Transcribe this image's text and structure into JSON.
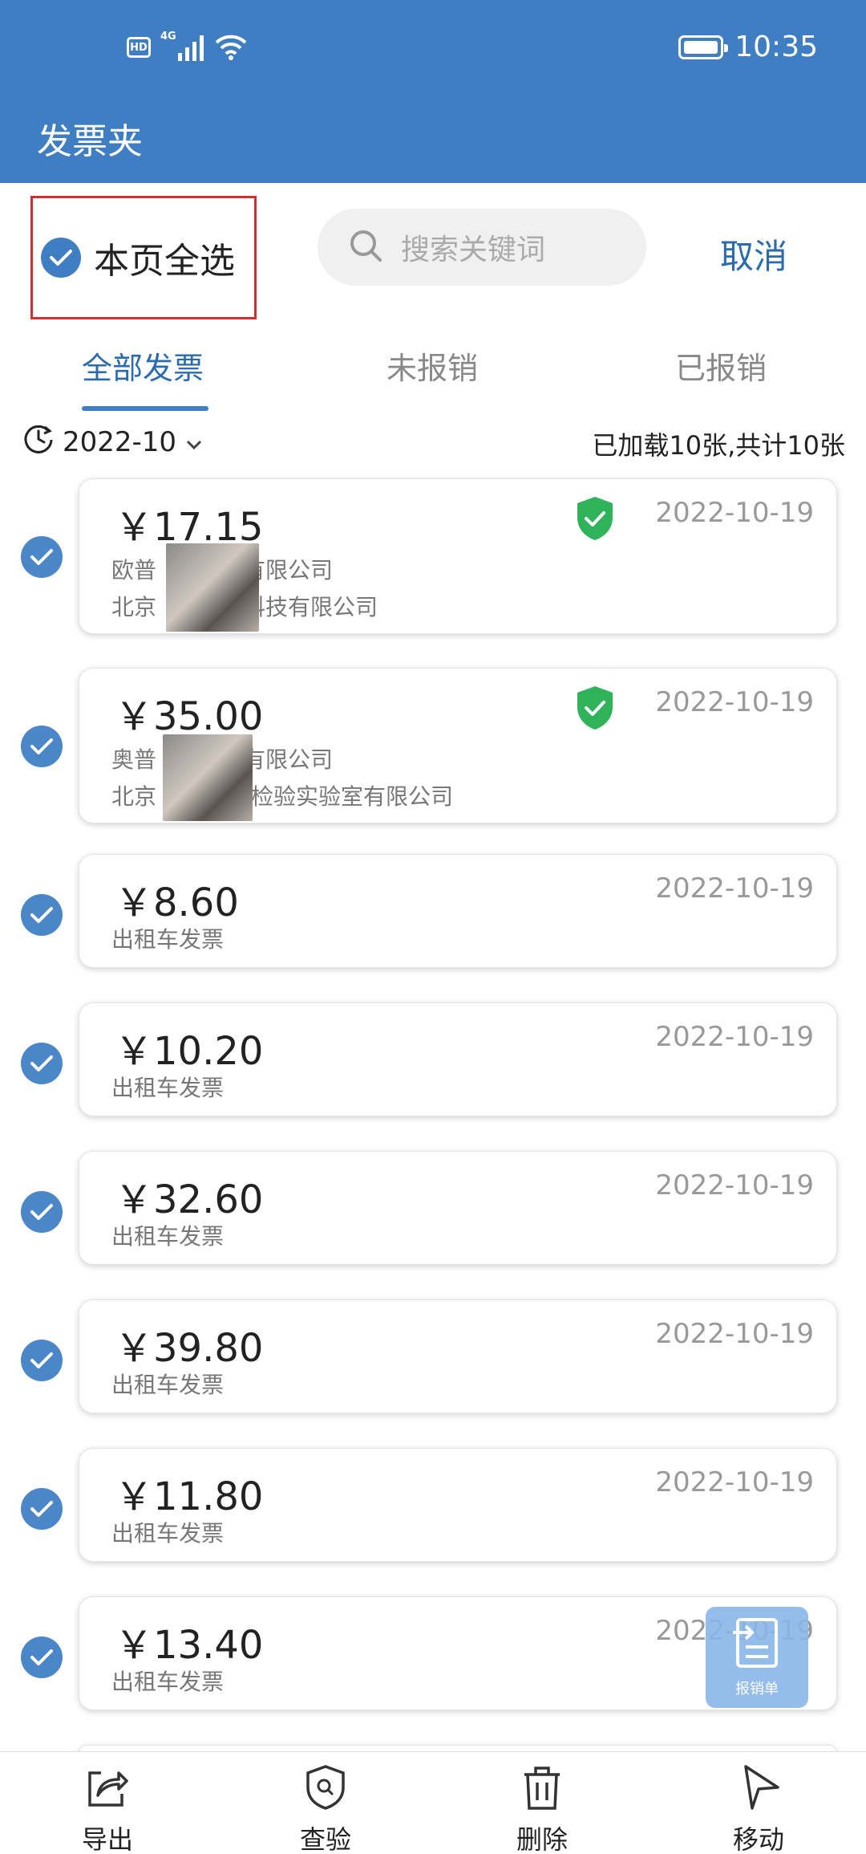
{
  "status_bar": {
    "hd": "HD",
    "network": "4G",
    "time": "10:35"
  },
  "header": {
    "title": "发票夹"
  },
  "toolbar": {
    "select_all_label": "本页全选",
    "search_placeholder": "搜索关键词",
    "cancel_label": "取消"
  },
  "tabs": [
    {
      "label": "全部发票",
      "active": true
    },
    {
      "label": "未报销",
      "active": false
    },
    {
      "label": "已报销",
      "active": false
    }
  ],
  "filter": {
    "month": "2022-10",
    "loaded_text": "已加载10张,共计10张"
  },
  "invoices": [
    {
      "amount": "￥17.15",
      "date": "2022-10-19",
      "line1": "欧普",
      "line1_tail": "技有限公司",
      "line2": "北京",
      "line2_tail": "科技有限公司",
      "verified": true
    },
    {
      "amount": "￥35.00",
      "date": "2022-10-19",
      "line1": "奥普",
      "line1_tail": "技有限公司",
      "line2": "北京",
      "line2_tail": "检验实验室有限公司",
      "verified": true
    },
    {
      "amount": "￥8.60",
      "date": "2022-10-19",
      "line1": "出租车发票"
    },
    {
      "amount": "￥10.20",
      "date": "2022-10-19",
      "line1": "出租车发票"
    },
    {
      "amount": "￥32.60",
      "date": "2022-10-19",
      "line1": "出租车发票"
    },
    {
      "amount": "￥39.80",
      "date": "2022-10-19",
      "line1": "出租车发票"
    },
    {
      "amount": "￥11.80",
      "date": "2022-10-19",
      "line1": "出租车发票"
    },
    {
      "amount": "￥13.40",
      "date": "2022-10-19",
      "line1": "出租车发票"
    }
  ],
  "fab": {
    "label": "报销单"
  },
  "bottom_bar": [
    {
      "label": "导出",
      "icon": "share-icon"
    },
    {
      "label": "查验",
      "icon": "shield-search-icon"
    },
    {
      "label": "删除",
      "icon": "trash-icon"
    },
    {
      "label": "移动",
      "icon": "send-icon"
    }
  ],
  "colors": {
    "header_bg": "#3f7ec2",
    "accent": "#2a6bb0",
    "verified_green": "#2fb35a",
    "highlight_box": "#d32f2f"
  }
}
